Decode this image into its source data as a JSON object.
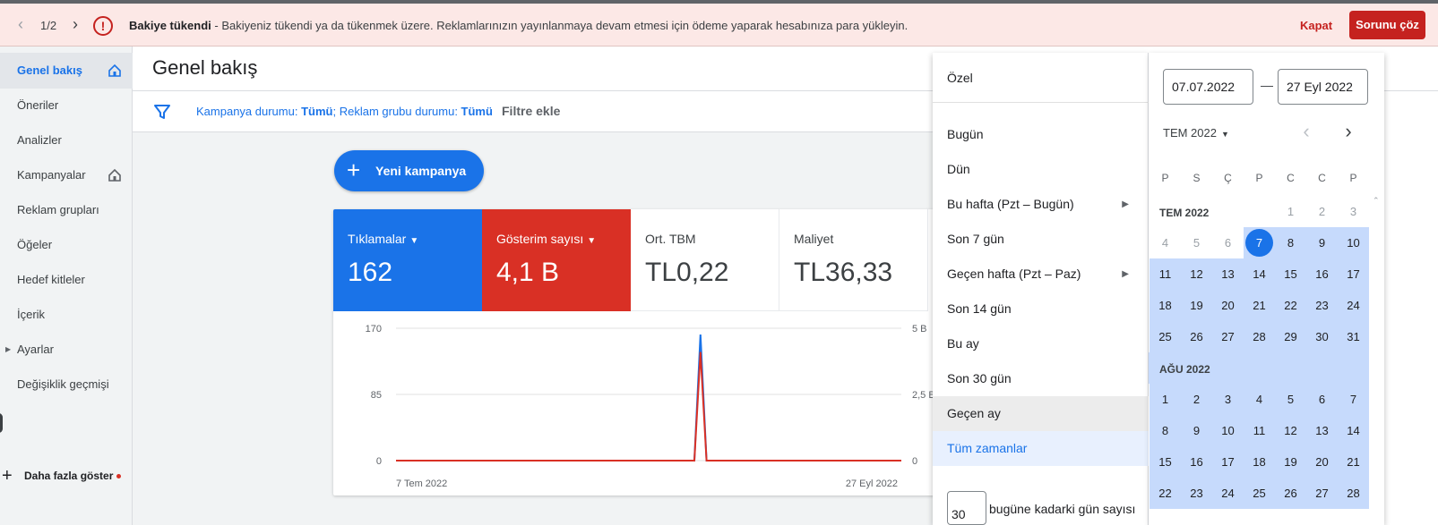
{
  "banner": {
    "pager": "1/2",
    "title": "Bakiye tükendi",
    "message": " - Bakiyeniz tükendi ya da tükenmek üzere. Reklamlarınızın yayınlanmaya devam etmesi için ödeme yaparak hesabınıza para yükleyin.",
    "close": "Kapat",
    "fix": "Sorunu çöz"
  },
  "sidebar": {
    "items": [
      {
        "label": "Genel bakış",
        "active": true,
        "home": true
      },
      {
        "label": "Öneriler"
      },
      {
        "label": "Analizler"
      },
      {
        "label": "Kampanyalar",
        "home": true
      },
      {
        "label": "Reklam grupları"
      },
      {
        "label": "Öğeler"
      },
      {
        "label": "Hedef kitleler"
      },
      {
        "label": "İçerik"
      },
      {
        "label": "Ayarlar",
        "expandable": true
      },
      {
        "label": "Değişiklik geçmişi"
      }
    ],
    "more": "Daha fazla göster"
  },
  "header": {
    "title": "Genel bakış"
  },
  "filters": {
    "campaign_label": "Kampanya durumu: ",
    "campaign_value": "Tümü",
    "sep": "; ",
    "adgroup_label": "Reklam grubu durumu: ",
    "adgroup_value": "Tümü",
    "add": "Filtre ekle"
  },
  "new_campaign": "Yeni kampanya",
  "metrics": [
    {
      "label": "Tıklamalar",
      "value": "162",
      "dropdown": true,
      "color": "#1a73e8"
    },
    {
      "label": "Gösterim sayısı",
      "value": "4,1 B",
      "dropdown": true,
      "color": "#d93025"
    },
    {
      "label": "Ort. TBM",
      "value": "TL0,22"
    },
    {
      "label": "Maliyet",
      "value": "TL36,33"
    }
  ],
  "chart_data": {
    "type": "line",
    "x_start_label": "7 Tem 2022",
    "x_end_label": "27 Eyl 2022",
    "left_axis": {
      "ticks": [
        "170",
        "85",
        "0"
      ],
      "ylim": [
        0,
        170
      ]
    },
    "right_axis": {
      "ticks": [
        "5 B",
        "2,5 B",
        "0"
      ],
      "ylim": [
        0,
        5000
      ]
    },
    "categories": [
      "7 Tem 2022",
      "",
      "",
      "",
      "",
      "",
      "",
      "",
      "",
      "",
      "",
      "",
      "",
      "",
      "",
      "",
      "",
      "",
      "",
      "",
      "",
      "",
      "",
      "",
      "",
      "",
      "",
      "",
      "",
      "",
      "",
      "",
      "",
      "",
      "",
      "",
      "",
      "",
      "",
      "",
      "",
      "",
      "",
      "",
      "",
      "",
      "",
      "",
      "",
      "",
      "",
      "",
      "",
      "",
      "",
      "",
      "",
      "",
      "",
      "",
      "",
      "",
      "",
      "",
      "",
      "",
      "",
      "",
      "",
      "",
      "",
      "",
      "",
      "",
      "",
      "",
      "",
      "",
      "",
      "",
      "",
      "",
      "",
      "27 Eyl 2022"
    ],
    "series": [
      {
        "name": "Tıklamalar",
        "axis": "left",
        "color": "#1a73e8",
        "peak_index": 50,
        "peak": 162,
        "values_other": 0
      },
      {
        "name": "Gösterim sayısı",
        "axis": "right",
        "color": "#d93025",
        "peak_index": 50,
        "peak": 4100,
        "values_other": 0
      }
    ]
  },
  "date_picker": {
    "custom": "Özel",
    "presets": [
      {
        "label": "Bugün"
      },
      {
        "label": "Dün"
      },
      {
        "label": "Bu hafta (Pzt – Bugün)",
        "submenu": true
      },
      {
        "label": "Son 7 gün"
      },
      {
        "label": "Geçen hafta (Pzt – Paz)",
        "submenu": true
      },
      {
        "label": "Son 14 gün"
      },
      {
        "label": "Bu ay"
      },
      {
        "label": "Son 30 gün"
      },
      {
        "label": "Geçen ay",
        "state": "hover"
      },
      {
        "label": "Tüm zamanlar",
        "state": "selected"
      }
    ],
    "days_value": "30",
    "days_text": "bugüne kadarki gün sayısı",
    "start_date": "07.07.2022",
    "end_date": "27 Eyl 2022",
    "dash": "—",
    "month_selector": "TEM 2022",
    "weekdays": [
      "P",
      "S",
      "Ç",
      "P",
      "C",
      "C",
      "P"
    ],
    "months": [
      {
        "label": "TEM 2022",
        "lead": [
          "1",
          "2",
          "3"
        ],
        "weeks": [
          [
            "4",
            "5",
            "6",
            "7",
            "8",
            "9",
            "10"
          ],
          [
            "11",
            "12",
            "13",
            "14",
            "15",
            "16",
            "17"
          ],
          [
            "18",
            "19",
            "20",
            "21",
            "22",
            "23",
            "24"
          ],
          [
            "25",
            "26",
            "27",
            "28",
            "29",
            "30",
            "31"
          ]
        ]
      },
      {
        "label": "AĞU 2022",
        "weeks": [
          [
            "1",
            "2",
            "3",
            "4",
            "5",
            "6",
            "7"
          ],
          [
            "8",
            "9",
            "10",
            "11",
            "12",
            "13",
            "14"
          ],
          [
            "15",
            "16",
            "17",
            "18",
            "19",
            "20",
            "21"
          ],
          [
            "22",
            "23",
            "24",
            "25",
            "26",
            "27",
            "28"
          ]
        ]
      }
    ],
    "start_day": "7"
  }
}
